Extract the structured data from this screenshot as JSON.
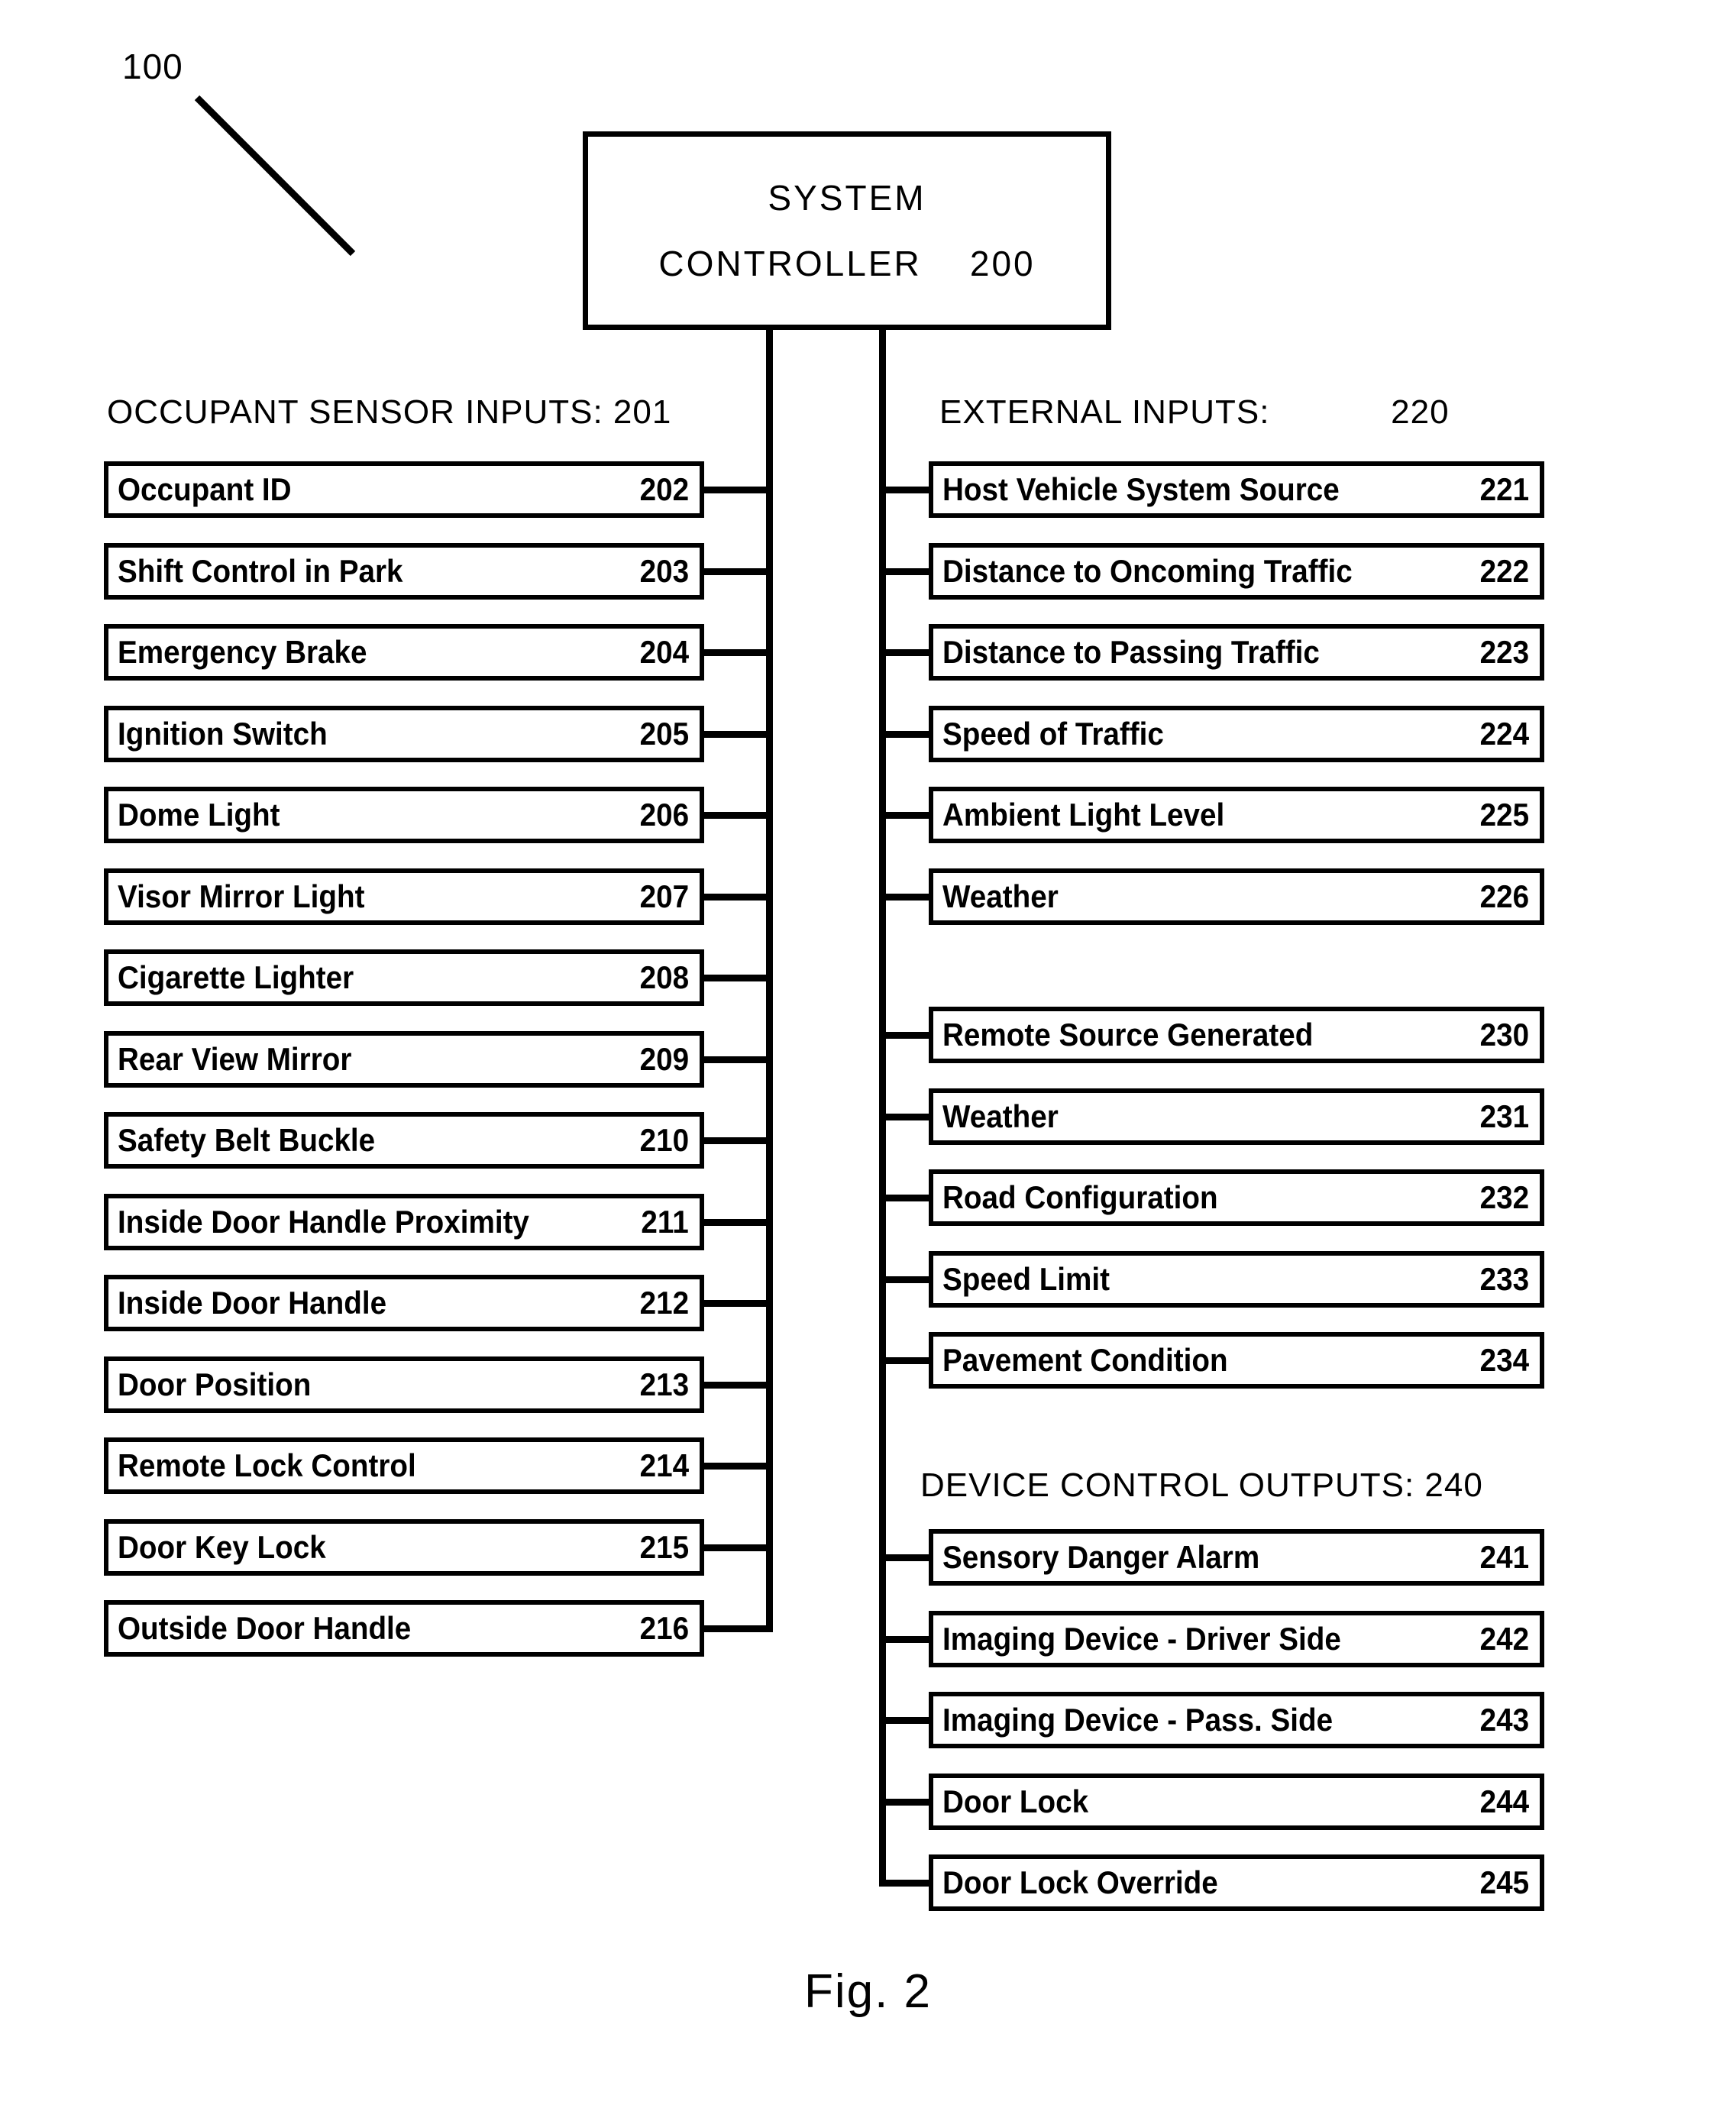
{
  "figure": {
    "caption": "Fig. 2",
    "reference_numeral": "100"
  },
  "controller": {
    "line1": "SYSTEM",
    "line2": "CONTROLLER    200",
    "title": "SYSTEM CONTROLLER",
    "numeral": "200"
  },
  "sections": {
    "occupant_sensor_inputs": {
      "heading": "OCCUPANT SENSOR INPUTS: 201",
      "numeral": "201",
      "items": [
        {
          "label": "Occupant ID",
          "numeral": "202"
        },
        {
          "label": "Shift Control in Park",
          "numeral": "203"
        },
        {
          "label": "Emergency Brake",
          "numeral": "204"
        },
        {
          "label": "Ignition Switch",
          "numeral": "205"
        },
        {
          "label": "Dome Light",
          "numeral": "206"
        },
        {
          "label": "Visor Mirror Light",
          "numeral": "207"
        },
        {
          "label": "Cigarette Lighter",
          "numeral": "208"
        },
        {
          "label": "Rear View Mirror",
          "numeral": "209"
        },
        {
          "label": "Safety Belt Buckle",
          "numeral": "210"
        },
        {
          "label": "Inside Door Handle Proximity",
          "numeral": "211"
        },
        {
          "label": "Inside Door Handle",
          "numeral": "212"
        },
        {
          "label": "Door Position",
          "numeral": "213"
        },
        {
          "label": "Remote Lock Control",
          "numeral": "214"
        },
        {
          "label": "Door Key Lock",
          "numeral": "215"
        },
        {
          "label": "Outside Door Handle",
          "numeral": "216"
        }
      ]
    },
    "external_inputs": {
      "heading": "EXTERNAL INPUTS:            220",
      "numeral": "220",
      "items": [
        {
          "label": "Host Vehicle System Source",
          "numeral": "221"
        },
        {
          "label": "Distance to Oncoming Traffic",
          "numeral": "222"
        },
        {
          "label": "Distance to Passing Traffic",
          "numeral": "223"
        },
        {
          "label": "Speed of Traffic",
          "numeral": "224"
        },
        {
          "label": "Ambient Light Level",
          "numeral": "225"
        },
        {
          "label": "Weather",
          "numeral": "226"
        }
      ]
    },
    "remote_source_group": {
      "items": [
        {
          "label": "Remote Source Generated",
          "numeral": "230"
        },
        {
          "label": "Weather",
          "numeral": "231"
        },
        {
          "label": "Road Configuration",
          "numeral": "232"
        },
        {
          "label": "Speed Limit",
          "numeral": "233"
        },
        {
          "label": "Pavement Condition",
          "numeral": "234"
        }
      ]
    },
    "device_control_outputs": {
      "heading": "DEVICE CONTROL OUTPUTS: 240",
      "numeral": "240",
      "items": [
        {
          "label": "Sensory Danger Alarm",
          "numeral": "241"
        },
        {
          "label": "Imaging Device - Driver Side",
          "numeral": "242"
        },
        {
          "label": "Imaging Device - Pass. Side",
          "numeral": "243"
        },
        {
          "label": "Door Lock",
          "numeral": "244"
        },
        {
          "label": "Door Lock  Override",
          "numeral": "245"
        }
      ]
    }
  },
  "colors": {
    "ink": "#000000",
    "paper": "#ffffff"
  }
}
